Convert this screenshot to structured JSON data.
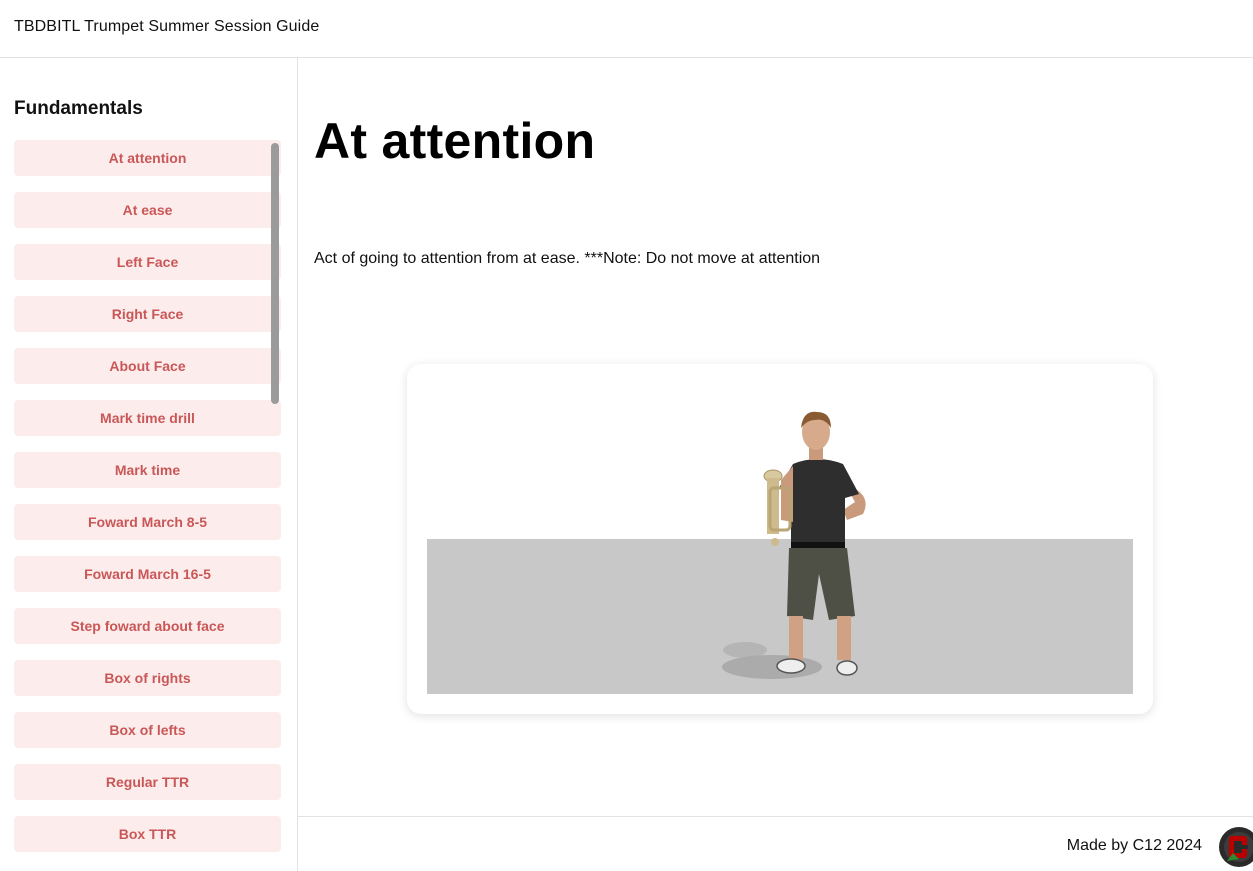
{
  "header": {
    "title": "TBDBITL Trumpet Summer Session Guide"
  },
  "sidebar": {
    "heading": "Fundamentals",
    "items": [
      {
        "label": "At attention"
      },
      {
        "label": "At ease"
      },
      {
        "label": "Left Face"
      },
      {
        "label": "Right Face"
      },
      {
        "label": "About Face"
      },
      {
        "label": "Mark time drill"
      },
      {
        "label": "Mark time"
      },
      {
        "label": "Foward March 8-5"
      },
      {
        "label": "Foward March 16-5"
      },
      {
        "label": "Step foward about face"
      },
      {
        "label": "Box of rights"
      },
      {
        "label": "Box of lefts"
      },
      {
        "label": "Regular TTR"
      },
      {
        "label": "Box TTR"
      }
    ]
  },
  "main": {
    "title": "At attention",
    "description": "Act of going to attention from at ease. ***Note: Do not move at attention"
  },
  "footer": {
    "credit": "Made by C12 2024"
  },
  "icons": {
    "logo": "block-o-logo-icon"
  },
  "colors": {
    "nav_bg": "#fdecec",
    "nav_text": "#c95757",
    "floor": "#c8c8c8"
  }
}
